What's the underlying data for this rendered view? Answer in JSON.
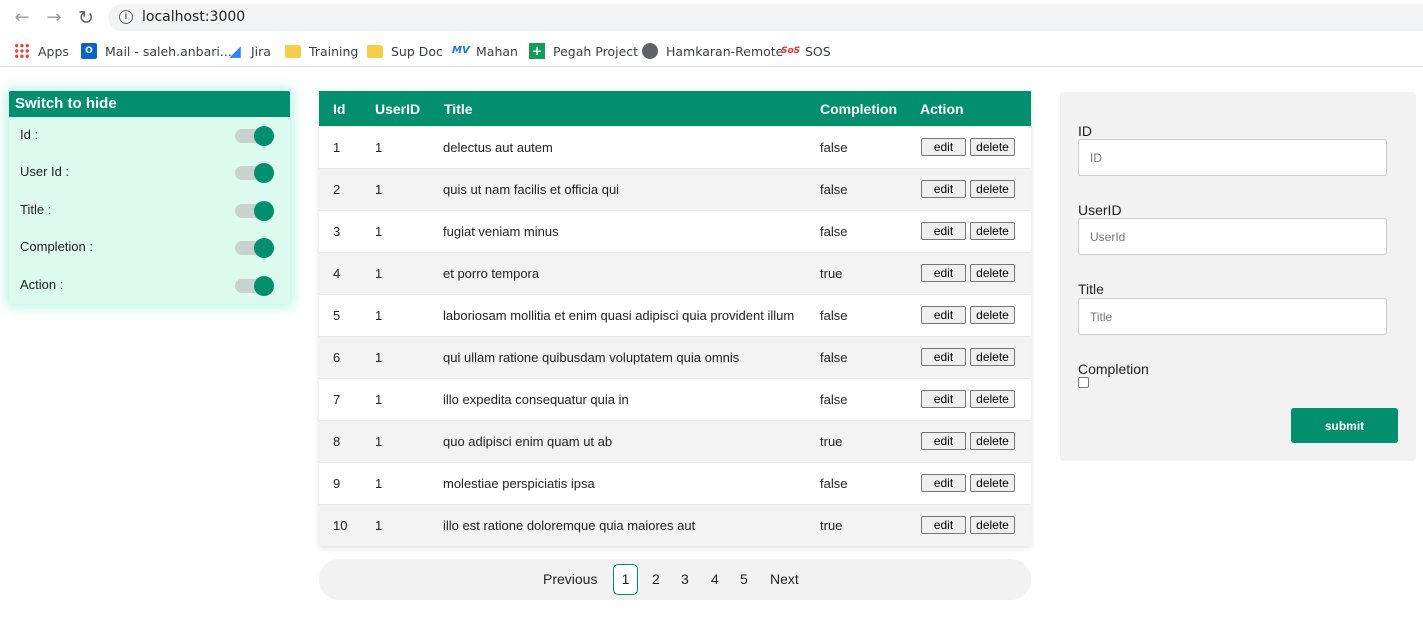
{
  "browser": {
    "url": "localhost:3000",
    "nav": {
      "back_icon": "←",
      "forward_icon": "→",
      "reload_icon": "↻"
    },
    "bookmarks": [
      {
        "label": "Apps",
        "icon": "apps-grid-icon"
      },
      {
        "label": "Mail - saleh.anbari...",
        "icon": "outlook-icon"
      },
      {
        "label": "Jira",
        "icon": "jira-icon"
      },
      {
        "label": "Training",
        "icon": "folder-icon"
      },
      {
        "label": "Sup Doc",
        "icon": "folder-icon"
      },
      {
        "label": "Mahan",
        "icon": "mahan-icon"
      },
      {
        "label": "Pegah Project",
        "icon": "pegah-icon"
      },
      {
        "label": "Hamkaran-Remote",
        "icon": "globe-icon"
      },
      {
        "label": "SOS",
        "icon": "sos-icon"
      }
    ]
  },
  "switch_panel": {
    "title": "Switch to hide",
    "items": [
      {
        "label": "Id :",
        "on": true
      },
      {
        "label": "User Id :",
        "on": true
      },
      {
        "label": "Title :",
        "on": true
      },
      {
        "label": "Completion :",
        "on": true
      },
      {
        "label": "Action :",
        "on": true
      }
    ]
  },
  "table": {
    "headers": {
      "id": "Id",
      "user": "UserID",
      "title": "Title",
      "completion": "Completion",
      "action": "Action"
    },
    "edit_label": "edit",
    "delete_label": "delete",
    "rows": [
      {
        "id": "1",
        "user": "1",
        "title": "delectus aut autem",
        "completion": "false"
      },
      {
        "id": "2",
        "user": "1",
        "title": "quis ut nam facilis et officia qui",
        "completion": "false"
      },
      {
        "id": "3",
        "user": "1",
        "title": "fugiat veniam minus",
        "completion": "false"
      },
      {
        "id": "4",
        "user": "1",
        "title": "et porro tempora",
        "completion": "true"
      },
      {
        "id": "5",
        "user": "1",
        "title": "laboriosam mollitia et enim quasi adipisci quia provident illum",
        "completion": "false"
      },
      {
        "id": "6",
        "user": "1",
        "title": "qui ullam ratione quibusdam voluptatem quia omnis",
        "completion": "false"
      },
      {
        "id": "7",
        "user": "1",
        "title": "illo expedita consequatur quia in",
        "completion": "false"
      },
      {
        "id": "8",
        "user": "1",
        "title": "quo adipisci enim quam ut ab",
        "completion": "true"
      },
      {
        "id": "9",
        "user": "1",
        "title": "molestiae perspiciatis ipsa",
        "completion": "false"
      },
      {
        "id": "10",
        "user": "1",
        "title": "illo est ratione doloremque quia maiores aut",
        "completion": "true"
      }
    ]
  },
  "pagination": {
    "previous": "Previous",
    "next": "Next",
    "pages": [
      "1",
      "2",
      "3",
      "4",
      "5"
    ],
    "current": "1"
  },
  "form": {
    "id": {
      "label": "ID",
      "placeholder": "ID"
    },
    "user": {
      "label": "UserID",
      "placeholder": "UserId"
    },
    "title": {
      "label": "Title",
      "placeholder": "Title"
    },
    "completion": {
      "label": "Completion",
      "checked": false
    },
    "submit": "submit"
  },
  "colors": {
    "accent": "#028f6e",
    "panel_bg": "#ddfaee",
    "form_bg": "#f2f2f2"
  }
}
